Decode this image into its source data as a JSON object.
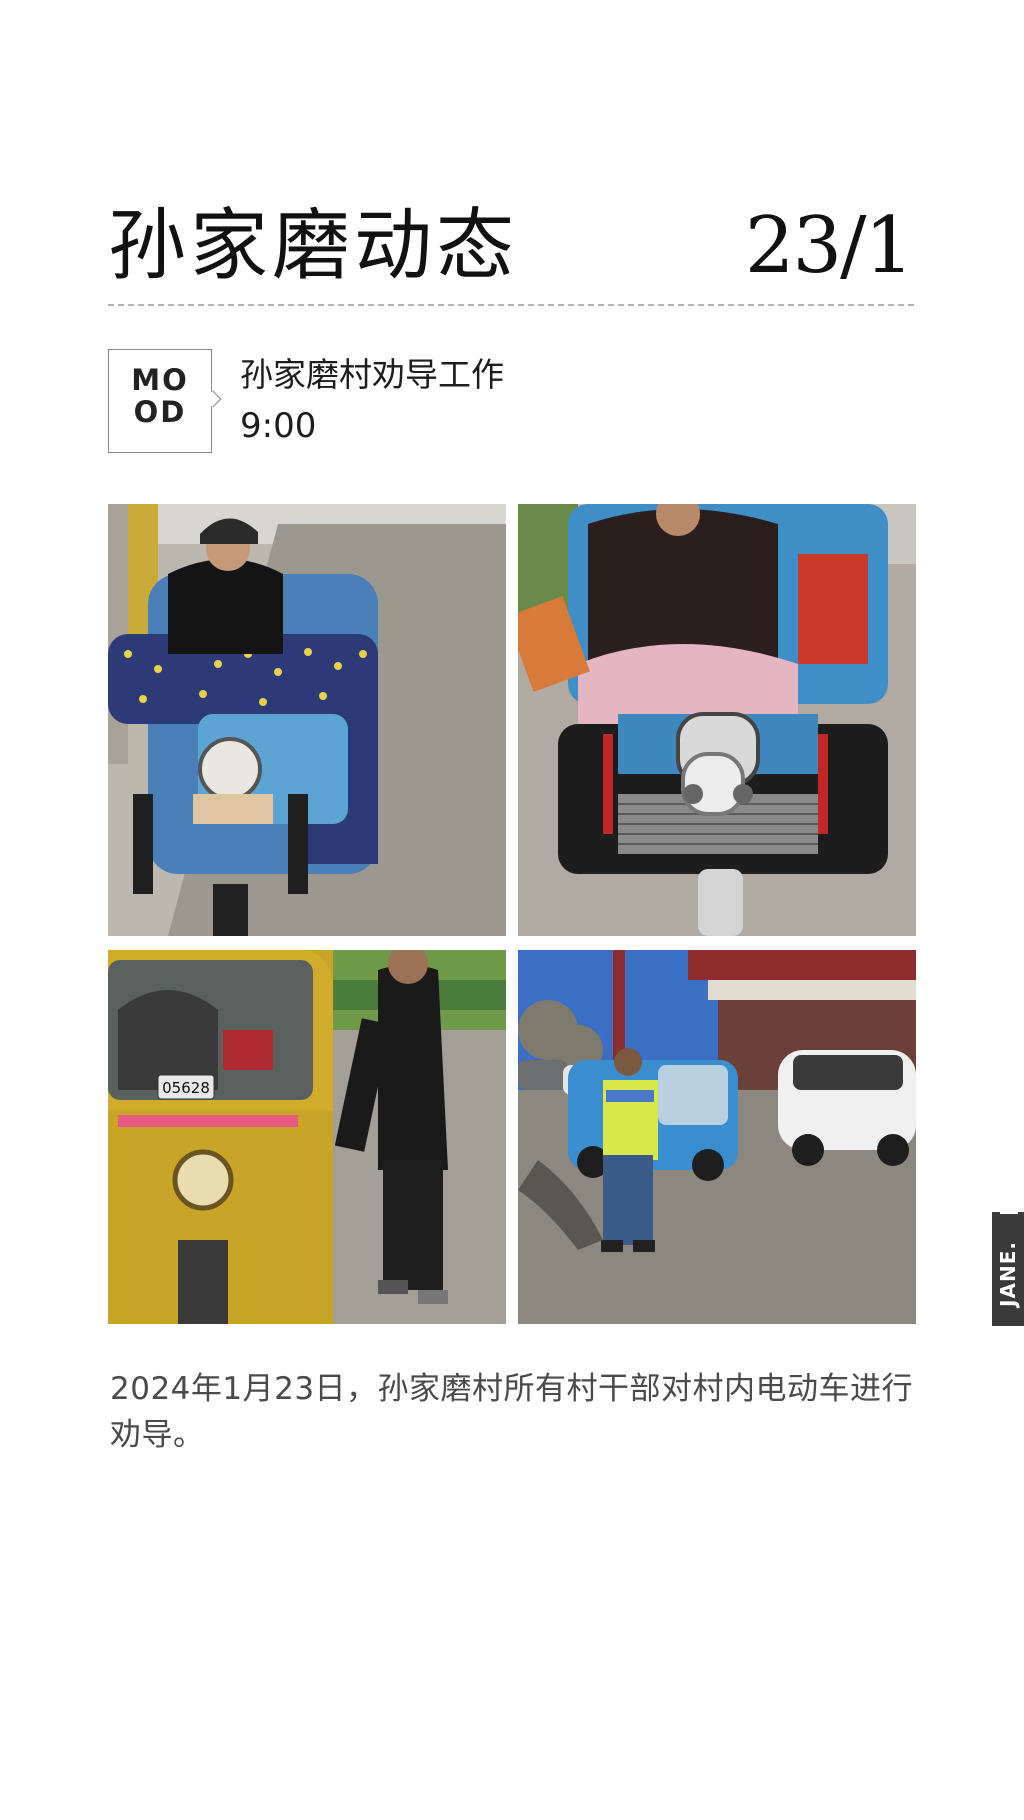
{
  "header": {
    "title": "孙家磨动态",
    "date": "23/1"
  },
  "mood": {
    "label_line1": "MO",
    "label_line2": "OD"
  },
  "activity": {
    "title": "孙家磨村劝导工作",
    "time": "9:00"
  },
  "photos": {
    "photo3_plate": "05628"
  },
  "caption": "2024年1月23日，孙家磨村所有村干部对村内电动车进行劝导。",
  "side_tag": "JANE.",
  "colors": {
    "text_primary": "#111111",
    "text_caption": "#4a4a4a",
    "divider": "#b5b5b5",
    "side_tag_bg": "#3a3a3a"
  }
}
